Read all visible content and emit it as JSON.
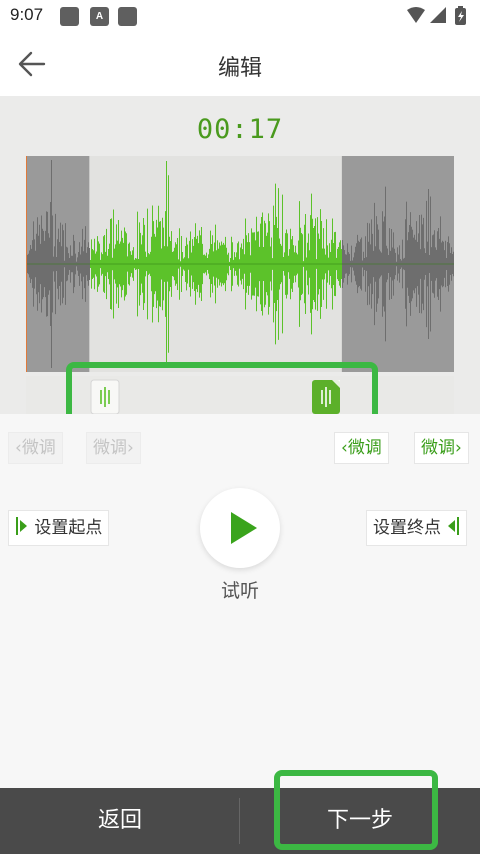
{
  "status": {
    "time": "9:07",
    "notif_letter": "A"
  },
  "header": {
    "title": "编辑"
  },
  "editor": {
    "timer": "00:17"
  },
  "controls": {
    "fine_tune_left_back": "微调",
    "fine_tune_left_fwd": "微调",
    "fine_tune_right_back": "微调",
    "fine_tune_right_fwd": "微调",
    "set_start": "设置起点",
    "set_end": "设置终点",
    "play_label": "试听"
  },
  "bottom": {
    "back_label": "返回",
    "next_label": "下一步"
  },
  "colors": {
    "accent": "#3a9e1a",
    "wave_selected": "#5cc22a",
    "wave_unselected": "#6e6e6e",
    "highlight": "#3cb843"
  },
  "selection": {
    "start_fraction": 0.148,
    "end_fraction": 0.738
  }
}
